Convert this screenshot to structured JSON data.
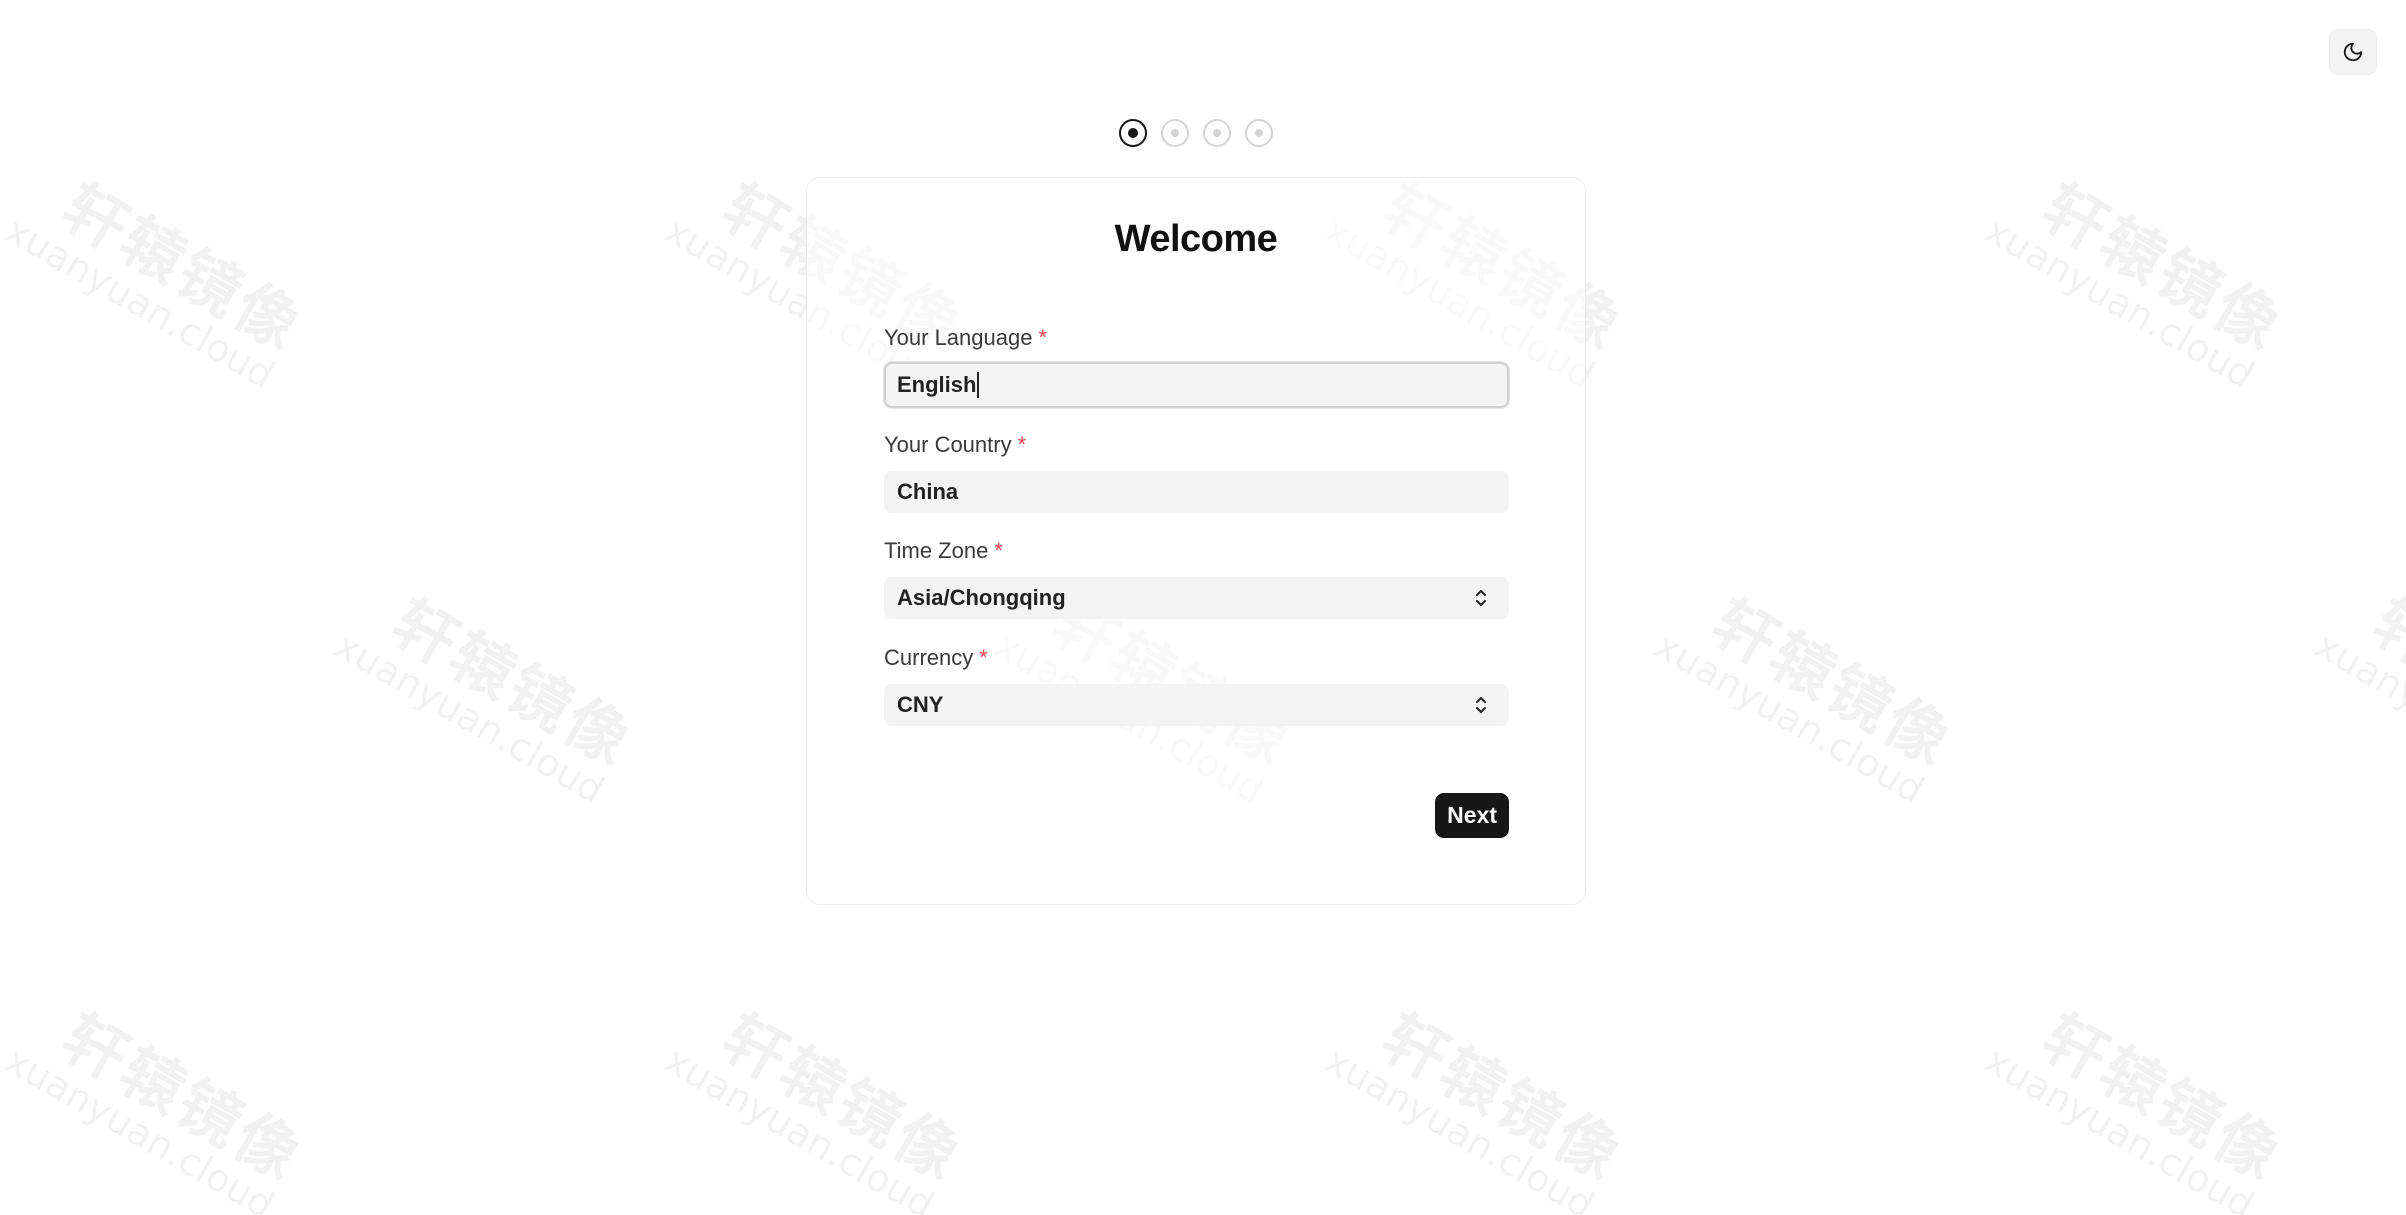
{
  "watermark": {
    "cn_text": "轩辕镜像",
    "en_text": "xuanyuan.cloud"
  },
  "theme_toggle": {
    "icon": "moon-icon"
  },
  "steps": {
    "total": 4,
    "current": 1
  },
  "card": {
    "title": "Welcome",
    "fields": {
      "language": {
        "label": "Your Language",
        "required_mark": "*",
        "value": "English"
      },
      "country": {
        "label": "Your Country",
        "required_mark": "*",
        "value": "China"
      },
      "timezone": {
        "label": "Time Zone",
        "required_mark": "*",
        "value": "Asia/Chongqing"
      },
      "currency": {
        "label": "Currency",
        "required_mark": "*",
        "value": "CNY"
      }
    },
    "next_label": "Next"
  },
  "colors": {
    "primary": "#171717",
    "required": "#e5484d",
    "input_bg": "#f3f3f3",
    "step_inactive": "#d4d4d4"
  }
}
